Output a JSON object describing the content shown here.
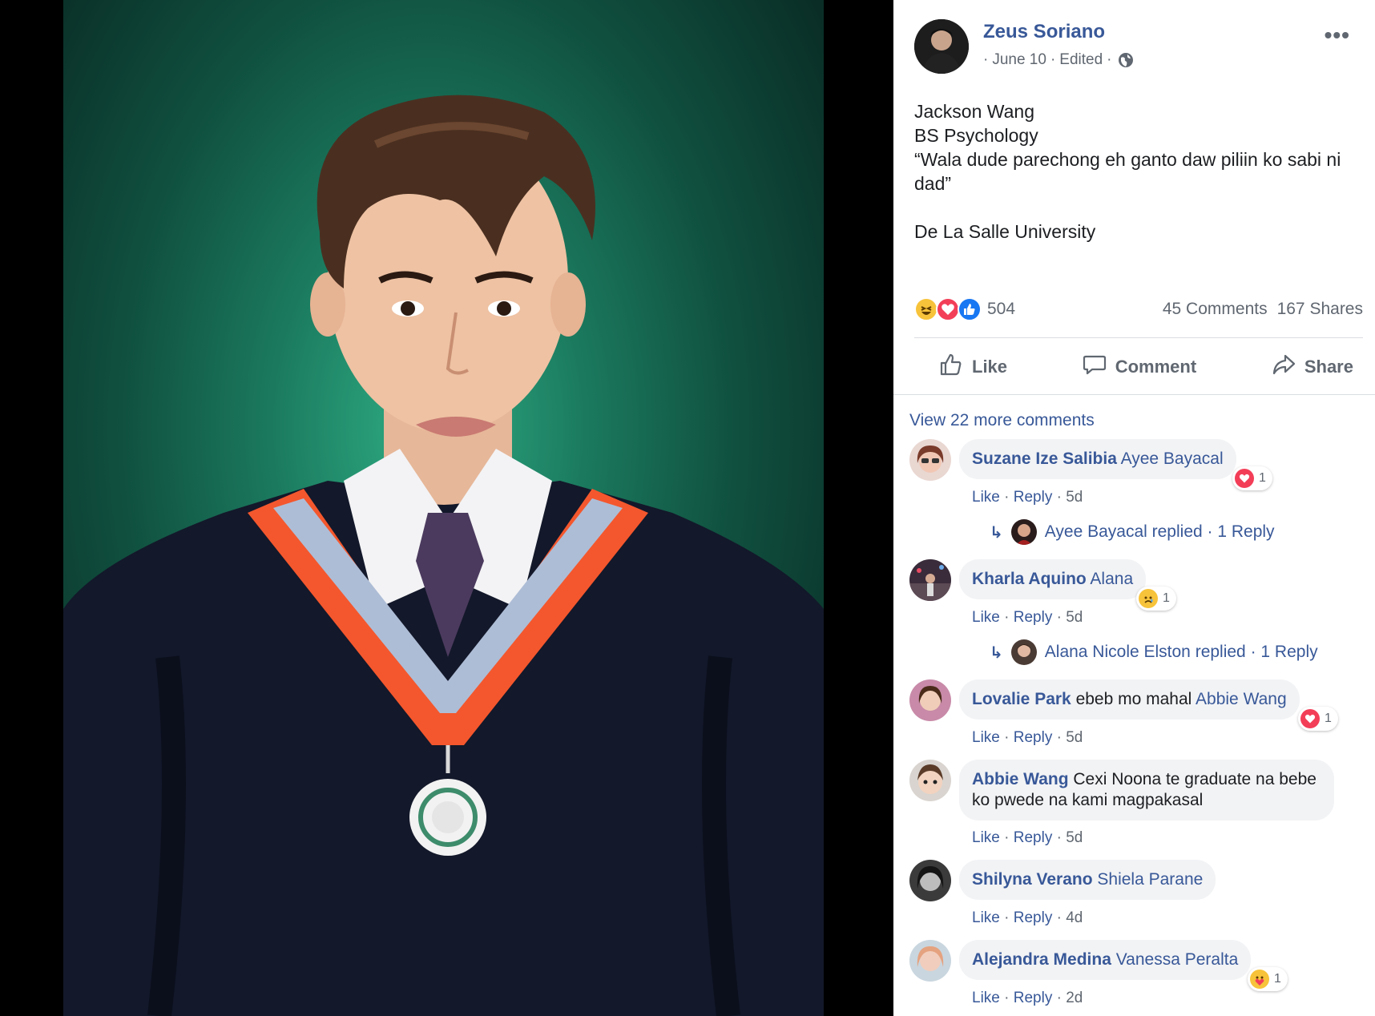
{
  "post": {
    "author": "Zeus Soriano",
    "date": "June 10",
    "edited": "Edited",
    "sep": "·",
    "more": "•••",
    "lines": [
      "Jackson Wang",
      "BS Psychology",
      "“Wala dude parechong eh ganto daw piliin ko sabi ni dad”",
      "",
      "De La Salle University"
    ]
  },
  "stats": {
    "reaction_count": "504",
    "comments": "45 Comments",
    "shares": "167 Shares"
  },
  "actions": {
    "like": "Like",
    "comment": "Comment",
    "share": "Share"
  },
  "comments": {
    "view_more": "View 22 more comments",
    "items": [
      {
        "name": "Suzane Ize Salibia",
        "tag": "Ayee Bayacal",
        "text": "",
        "time": "5d",
        "reaction": "love",
        "reaction_count": "1",
        "reply": {
          "name": "Ayee Bayacal",
          "label": "Ayee Bayacal replied · 1 Reply"
        }
      },
      {
        "name": "Kharla Aquino",
        "tag": "Alana",
        "text": "",
        "time": "5d",
        "reaction": "sad",
        "reaction_count": "1",
        "reply": {
          "name": "Alana Nicole Elston",
          "label": "Alana Nicole Elston replied · 1 Reply"
        }
      },
      {
        "name": "Lovalie Park",
        "tag": "Abbie Wang",
        "text": "ebeb mo mahal",
        "time": "5d",
        "reaction": "love",
        "reaction_count": "1"
      },
      {
        "name": "Abbie Wang",
        "tag": "",
        "text": "Cexi Noona te graduate na bebe ko pwede na kami magpakasal",
        "time": "5d"
      },
      {
        "name": "Shilyna Verano",
        "tag": "Shiela Parane",
        "text": "",
        "time": "4d"
      },
      {
        "name": "Alejandra Medina",
        "tag": "Vanessa Peralta",
        "text": "",
        "time": "2d",
        "reaction": "care",
        "reaction_count": "1"
      }
    ],
    "like_label": "Like",
    "reply_label": "Reply",
    "dot": "·"
  },
  "colors": {
    "link": "#385898",
    "muted": "#606770",
    "bubble": "#f2f3f5",
    "gown": "#13182a",
    "stole_orange": "#f4572d",
    "stole_silver": "#aebdd6"
  },
  "icons": [
    "globe-icon",
    "like-icon",
    "comment-icon",
    "share-icon",
    "haha-icon",
    "love-icon",
    "sad-icon",
    "care-icon",
    "reply-arrow-icon"
  ]
}
